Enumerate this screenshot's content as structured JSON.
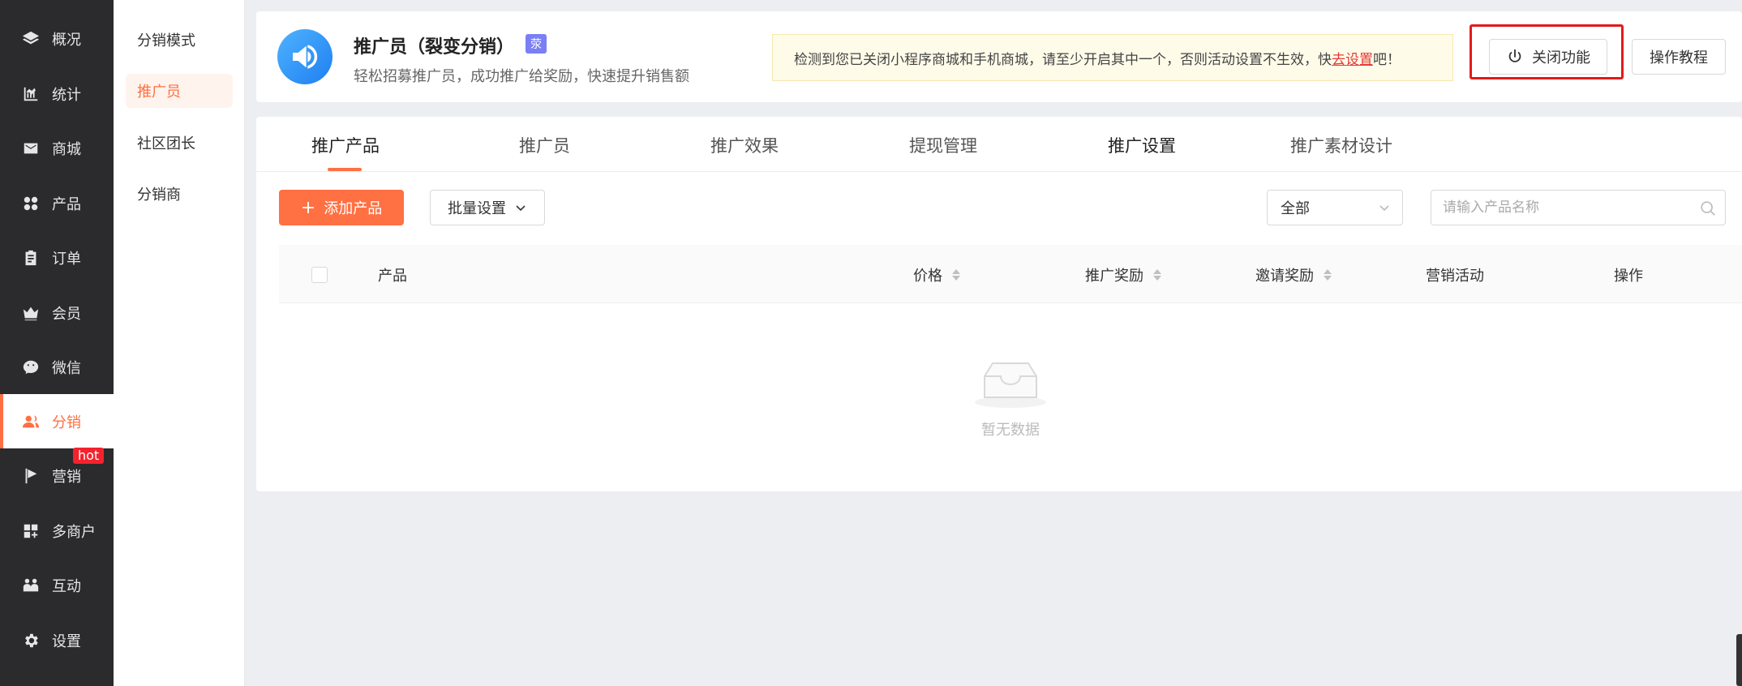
{
  "nav": {
    "items": [
      {
        "label": "概况",
        "icon": "layers-icon"
      },
      {
        "label": "统计",
        "icon": "chart-icon"
      },
      {
        "label": "商城",
        "icon": "mail-icon"
      },
      {
        "label": "产品",
        "icon": "grid-icon"
      },
      {
        "label": "订单",
        "icon": "clipboard-icon"
      },
      {
        "label": "会员",
        "icon": "crown-icon"
      },
      {
        "label": "微信",
        "icon": "wechat-icon"
      },
      {
        "label": "分销",
        "icon": "users-icon"
      },
      {
        "label": "营销",
        "icon": "flag-icon"
      },
      {
        "label": "多商户",
        "icon": "store-icon"
      },
      {
        "label": "互动",
        "icon": "people-icon"
      },
      {
        "label": "设置",
        "icon": "gear-icon"
      }
    ],
    "hot_badge": "hot"
  },
  "subnav": {
    "items": [
      {
        "label": "分销模式"
      },
      {
        "label": "推广员"
      },
      {
        "label": "社区团长"
      },
      {
        "label": "分销商"
      }
    ]
  },
  "header": {
    "title": "推广员（裂变分销）",
    "tag": "荥",
    "subtitle": "轻松招募推广员，成功推广给奖励，快速提升销售额",
    "notice_prefix": "检测到您已关闭小程序商城和手机商城，请至少开启其中一个，否则活动设置不生效，快",
    "notice_link": "去设置",
    "notice_suffix": "吧！",
    "close_label": "关闭功能",
    "guide_label": "操作教程"
  },
  "tabs": [
    {
      "label": "推广产品"
    },
    {
      "label": "推广员"
    },
    {
      "label": "推广效果"
    },
    {
      "label": "提现管理"
    },
    {
      "label": "推广设置"
    },
    {
      "label": "推广素材设计"
    }
  ],
  "toolbar": {
    "add_label": "添加产品",
    "batch_label": "批量设置",
    "filter_value": "全部",
    "search_placeholder": "请输入产品名称"
  },
  "table": {
    "columns": [
      "产品",
      "价格",
      "推广奖励",
      "邀请奖励",
      "营销活动",
      "操作"
    ],
    "empty_text": "暂无数据"
  },
  "colors": {
    "accent": "#ff7043",
    "nav_bg": "#2b2b2d",
    "alert_red": "#e31a1a"
  }
}
